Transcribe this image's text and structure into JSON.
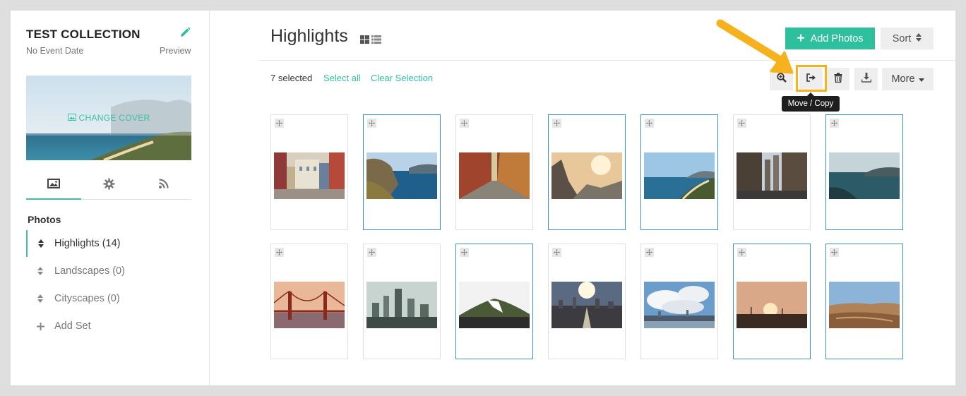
{
  "sidebar": {
    "collection_title": "TEST COLLECTION",
    "event_date": "No Event Date",
    "preview_label": "Preview",
    "change_cover_label": "CHANGE COVER",
    "tabs": [
      {
        "name": "photos",
        "icon": "image-icon",
        "active": true
      },
      {
        "name": "settings",
        "icon": "gear-icon",
        "active": false
      },
      {
        "name": "feed",
        "icon": "rss-icon",
        "active": false
      }
    ],
    "photos_heading": "Photos",
    "sets": [
      {
        "label": "Highlights (14)",
        "active": true
      },
      {
        "label": "Landscapes (0)",
        "active": false
      },
      {
        "label": "Cityscapes (0)",
        "active": false
      }
    ],
    "add_set_label": "Add Set"
  },
  "main": {
    "title": "Highlights",
    "add_photos_label": "Add Photos",
    "sort_label": "Sort",
    "selected_count": "7 selected",
    "select_all_label": "Select all",
    "clear_selection_label": "Clear Selection",
    "more_label": "More",
    "tooltip": "Move / Copy",
    "toolbar_icons": [
      "zoom-in-icon",
      "move-copy-icon",
      "trash-icon",
      "download-icon"
    ]
  },
  "colors": {
    "accent": "#2ebf9d",
    "selected_border": "#3c8fd0",
    "highlight": "#f5b21c"
  },
  "photos": [
    {
      "subject": "colorful street",
      "selected": false
    },
    {
      "subject": "coastal cliffs",
      "selected": true
    },
    {
      "subject": "narrow alley",
      "selected": false
    },
    {
      "subject": "misty mountain",
      "selected": true
    },
    {
      "subject": "beach coastline",
      "selected": true
    },
    {
      "subject": "city street",
      "selected": false
    },
    {
      "subject": "lake mountains",
      "selected": true
    },
    {
      "subject": "golden gate bridge",
      "selected": false
    },
    {
      "subject": "foggy city",
      "selected": false
    },
    {
      "subject": "snowy hill",
      "selected": true
    },
    {
      "subject": "city skyline sunburst",
      "selected": false
    },
    {
      "subject": "cloudy skyline",
      "selected": false
    },
    {
      "subject": "sunset field",
      "selected": true
    },
    {
      "subject": "desert canyon",
      "selected": true
    }
  ]
}
